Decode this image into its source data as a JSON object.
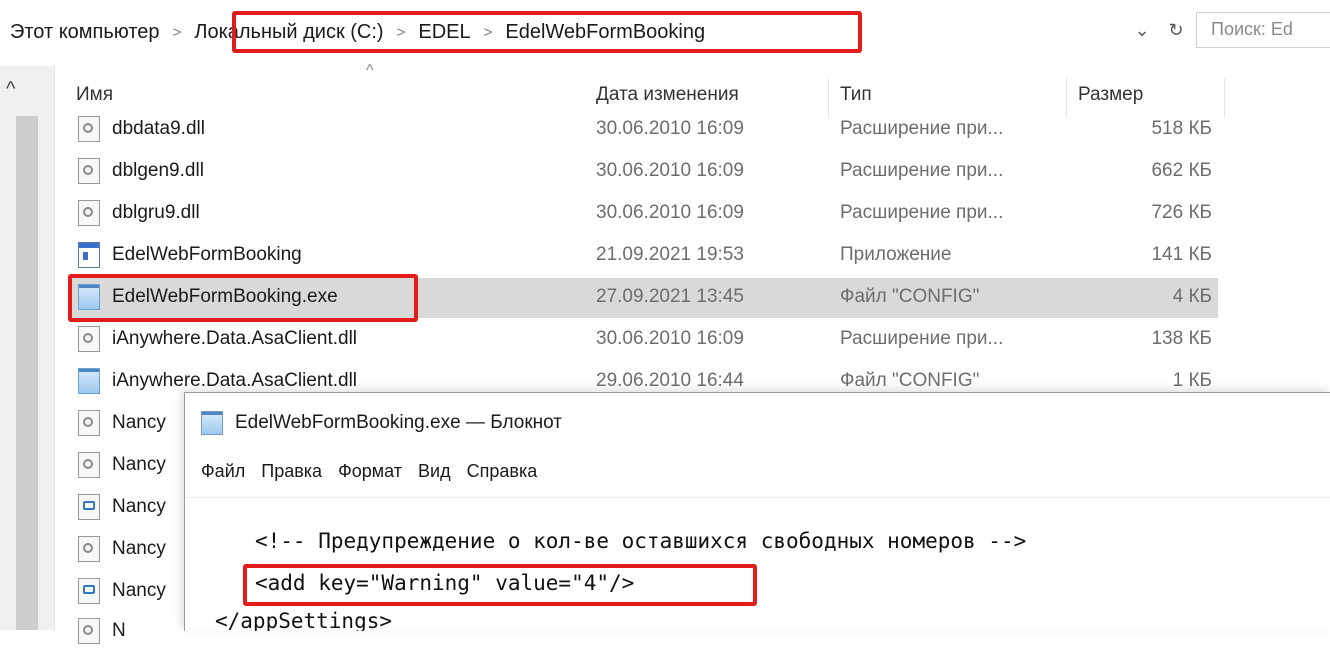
{
  "explorer": {
    "breadcrumb": [
      {
        "label": "Этот компьютер"
      },
      {
        "label": "Локальный диск (C:)"
      },
      {
        "label": "EDEL"
      },
      {
        "label": "EdelWebFormBooking"
      }
    ],
    "search_placeholder": "Поиск: Ed",
    "columns": {
      "name": "Имя",
      "date": "Дата изменения",
      "type": "Тип",
      "size": "Размер"
    },
    "files": [
      {
        "name": "dbdata9.dll",
        "date": "30.06.2010 16:09",
        "type": "Расширение при...",
        "size": "518 КБ",
        "icon": "dll-file-icon"
      },
      {
        "name": "dblgen9.dll",
        "date": "30.06.2010 16:09",
        "type": "Расширение при...",
        "size": "662 КБ",
        "icon": "dll-file-icon"
      },
      {
        "name": "dblgru9.dll",
        "date": "30.06.2010 16:09",
        "type": "Расширение при...",
        "size": "726 КБ",
        "icon": "dll-file-icon"
      },
      {
        "name": "EdelWebFormBooking",
        "date": "21.09.2021 19:53",
        "type": "Приложение",
        "size": "141 КБ",
        "icon": "application-icon"
      },
      {
        "name": "EdelWebFormBooking.exe",
        "date": "27.09.2021 13:45",
        "type": "Файл \"CONFIG\"",
        "size": "4 КБ",
        "icon": "config-file-icon",
        "selected": true
      },
      {
        "name": "iAnywhere.Data.AsaClient.dll",
        "date": "30.06.2010 16:09",
        "type": "Расширение при...",
        "size": "138 КБ",
        "icon": "dll-file-icon"
      },
      {
        "name": "iAnywhere.Data.AsaClient.dll",
        "date": "29.06.2010 16:44",
        "type": "Файл \"CONFIG\"",
        "size": "1 КБ",
        "icon": "config-file-icon"
      }
    ],
    "partial_names": [
      "Nancy",
      "Nancy",
      "Nancy",
      "Nancy",
      "Nancy",
      "N"
    ]
  },
  "notepad": {
    "title": "EdelWebFormBooking.exe — Блокнот",
    "menu": [
      "Файл",
      "Правка",
      "Формат",
      "Вид",
      "Справка"
    ],
    "lines": [
      "<!-- Предупреждение о кол-ве оставшихся свободных номеров -->",
      "<add key=\"Warning\" value=\"4\"/>",
      "</appSettings>"
    ]
  },
  "colors": {
    "highlight": "#e21b1b",
    "selected_row": "#d9d9d9"
  }
}
